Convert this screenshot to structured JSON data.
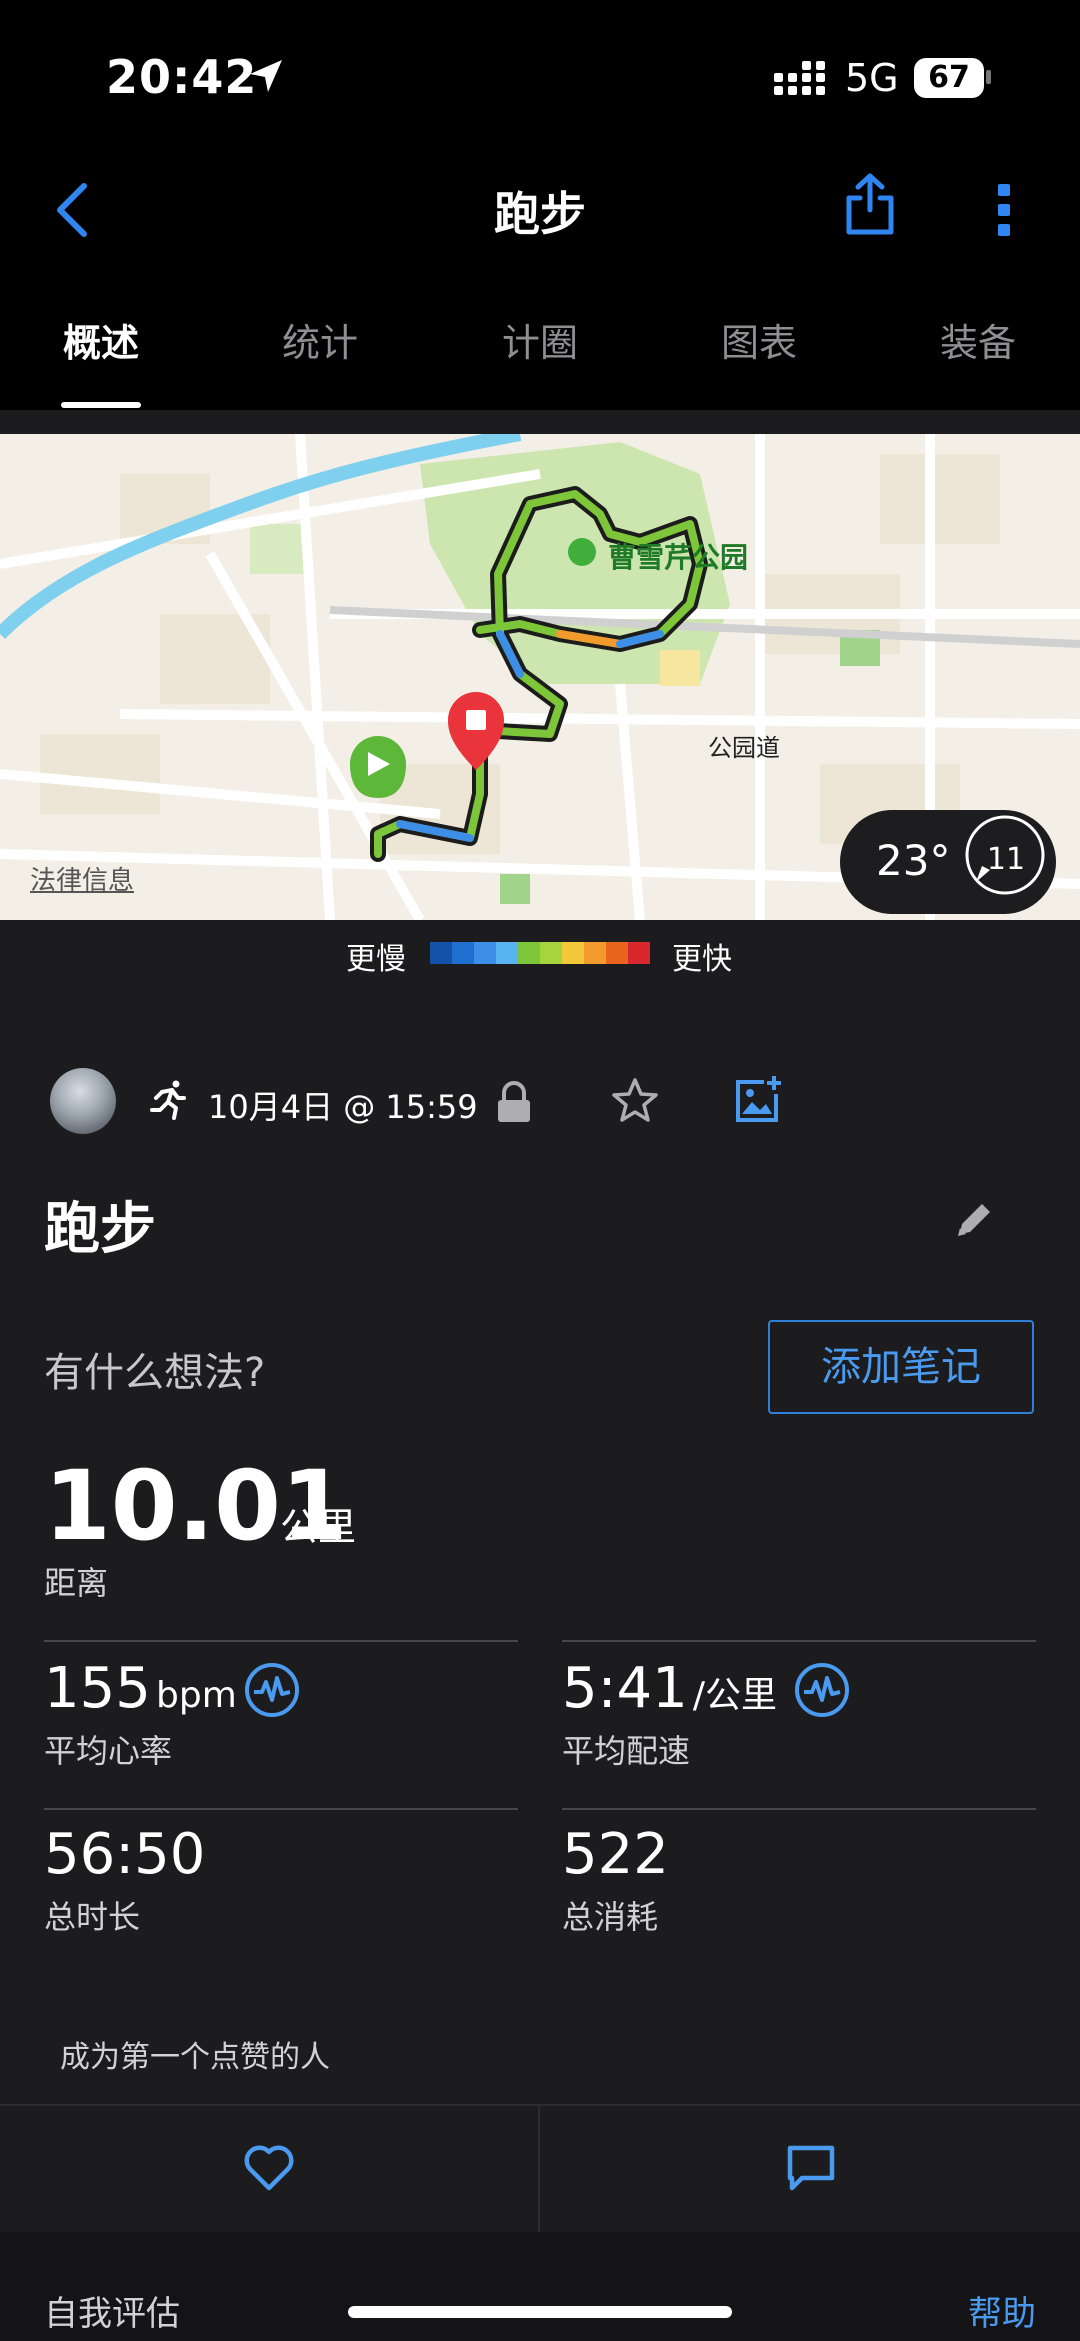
{
  "status_bar": {
    "time": "20:42",
    "network": "5G",
    "battery": "67"
  },
  "header": {
    "title": "跑步"
  },
  "tabs": [
    {
      "label": "概述",
      "active": true
    },
    {
      "label": "统计"
    },
    {
      "label": "计圈"
    },
    {
      "label": "图表"
    },
    {
      "label": "装备"
    }
  ],
  "map": {
    "park_name": "曹雪芹公园",
    "road_name": "公园道",
    "legal_link": "法律信息",
    "weather": {
      "temperature": "23°",
      "wind": "11"
    }
  },
  "pace_legend": {
    "slow": "更慢",
    "fast": "更快",
    "colors": [
      "#1451a8",
      "#1f6fd0",
      "#3d8ee6",
      "#58b3f0",
      "#7dc63a",
      "#a6d43d",
      "#f3c93a",
      "#f39a2d",
      "#e9641f",
      "#d8282e"
    ]
  },
  "activity": {
    "date": "10月4日 @ 15:59",
    "title": "跑步",
    "thoughts_prompt": "有什么想法?",
    "add_note_label": "添加笔记"
  },
  "stats": {
    "distance": {
      "value": "10.01",
      "unit": "公里",
      "label": "距离"
    },
    "avg_hr": {
      "value": "155",
      "unit": "bpm",
      "label": "平均心率"
    },
    "avg_pace": {
      "value": "5:41",
      "unit": "/公里",
      "label": "平均配速"
    },
    "duration": {
      "value": "56:50",
      "label": "总时长"
    },
    "calories": {
      "value": "522",
      "label": "总消耗"
    }
  },
  "social": {
    "likes_prompt": "成为第一个点赞的人"
  },
  "footer": {
    "self_eval": "自我评估",
    "help": "帮助"
  },
  "colors": {
    "accent": "#4a9af0",
    "background": "#1c1c1e",
    "header_bg": "#000000"
  }
}
